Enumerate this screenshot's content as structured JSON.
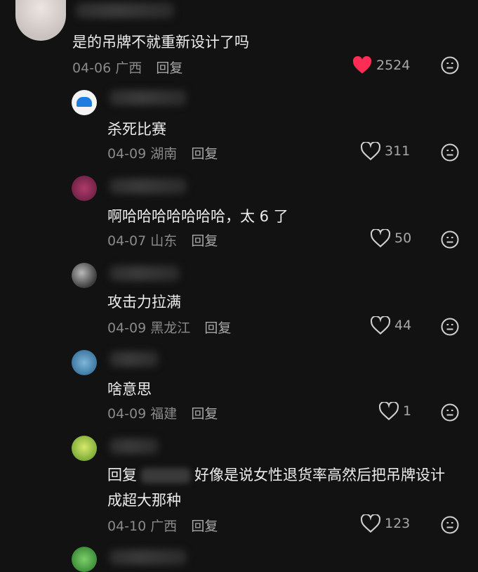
{
  "top_comment": {
    "text": "是的吊牌不就重新设计了吗",
    "date": "04-06",
    "location": "广西",
    "reply_label": "回复",
    "likes": "2524",
    "liked": true
  },
  "replies": [
    {
      "text": "杀死比赛",
      "date": "04-09",
      "location": "湖南",
      "reply_label": "回复",
      "likes": "311"
    },
    {
      "text": "啊哈哈哈哈哈哈哈，太 6 了",
      "date": "04-07",
      "location": "山东",
      "reply_label": "回复",
      "likes": "50"
    },
    {
      "text": "攻击力拉满",
      "date": "04-09",
      "location": "黑龙江",
      "reply_label": "回复",
      "likes": "44"
    },
    {
      "text": "啥意思",
      "date": "04-09",
      "location": "福建",
      "reply_label": "回复",
      "likes": "1"
    },
    {
      "reply_prefix": "回复",
      "text_line1": "好像是说女性退货率高然后把吊牌设计",
      "text_line2": "成超大那种",
      "date": "04-10",
      "location": "广西",
      "reply_label": "回复",
      "likes": "123"
    }
  ],
  "icons": {
    "like": "heart-icon",
    "dislike": "neutral-face-icon"
  },
  "colors": {
    "liked": "#ff2d55",
    "background": "#121212"
  }
}
